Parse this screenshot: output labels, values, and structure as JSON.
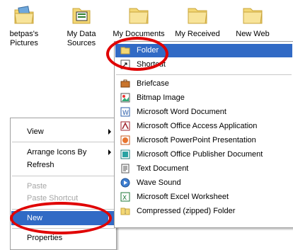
{
  "desktop": {
    "icons": [
      {
        "label_line1": "betpas's",
        "label_line2": "Pictures"
      },
      {
        "label_line1": "My Data",
        "label_line2": "Sources"
      },
      {
        "label_line1": "My Documents",
        "label_line2": ""
      },
      {
        "label_line1": "My Received",
        "label_line2": ""
      },
      {
        "label_line1": "New Web",
        "label_line2": ""
      }
    ]
  },
  "context_menu": {
    "items": {
      "view": "View",
      "arrange": "Arrange Icons By",
      "refresh": "Refresh",
      "paste": "Paste",
      "paste_shortcut": "Paste Shortcut",
      "new": "New",
      "properties": "Properties"
    }
  },
  "submenu": {
    "folder": "Folder",
    "shortcut": "Shortcut",
    "items": [
      {
        "label": "Briefcase",
        "icon": "briefcase-icon"
      },
      {
        "label": "Bitmap Image",
        "icon": "bitmap-icon"
      },
      {
        "label": "Microsoft Word Document",
        "icon": "word-icon"
      },
      {
        "label": "Microsoft Office Access Application",
        "icon": "access-icon"
      },
      {
        "label": "Microsoft PowerPoint Presentation",
        "icon": "powerpoint-icon"
      },
      {
        "label": "Microsoft Office Publisher Document",
        "icon": "publisher-icon"
      },
      {
        "label": "Text Document",
        "icon": "text-document-icon"
      },
      {
        "label": "Wave Sound",
        "icon": "wave-sound-icon"
      },
      {
        "label": "Microsoft Excel Worksheet",
        "icon": "excel-icon"
      },
      {
        "label": "Compressed (zipped) Folder",
        "icon": "zip-folder-icon"
      }
    ]
  },
  "colors": {
    "highlight": "#316ac5",
    "annotation": "#e00000"
  }
}
